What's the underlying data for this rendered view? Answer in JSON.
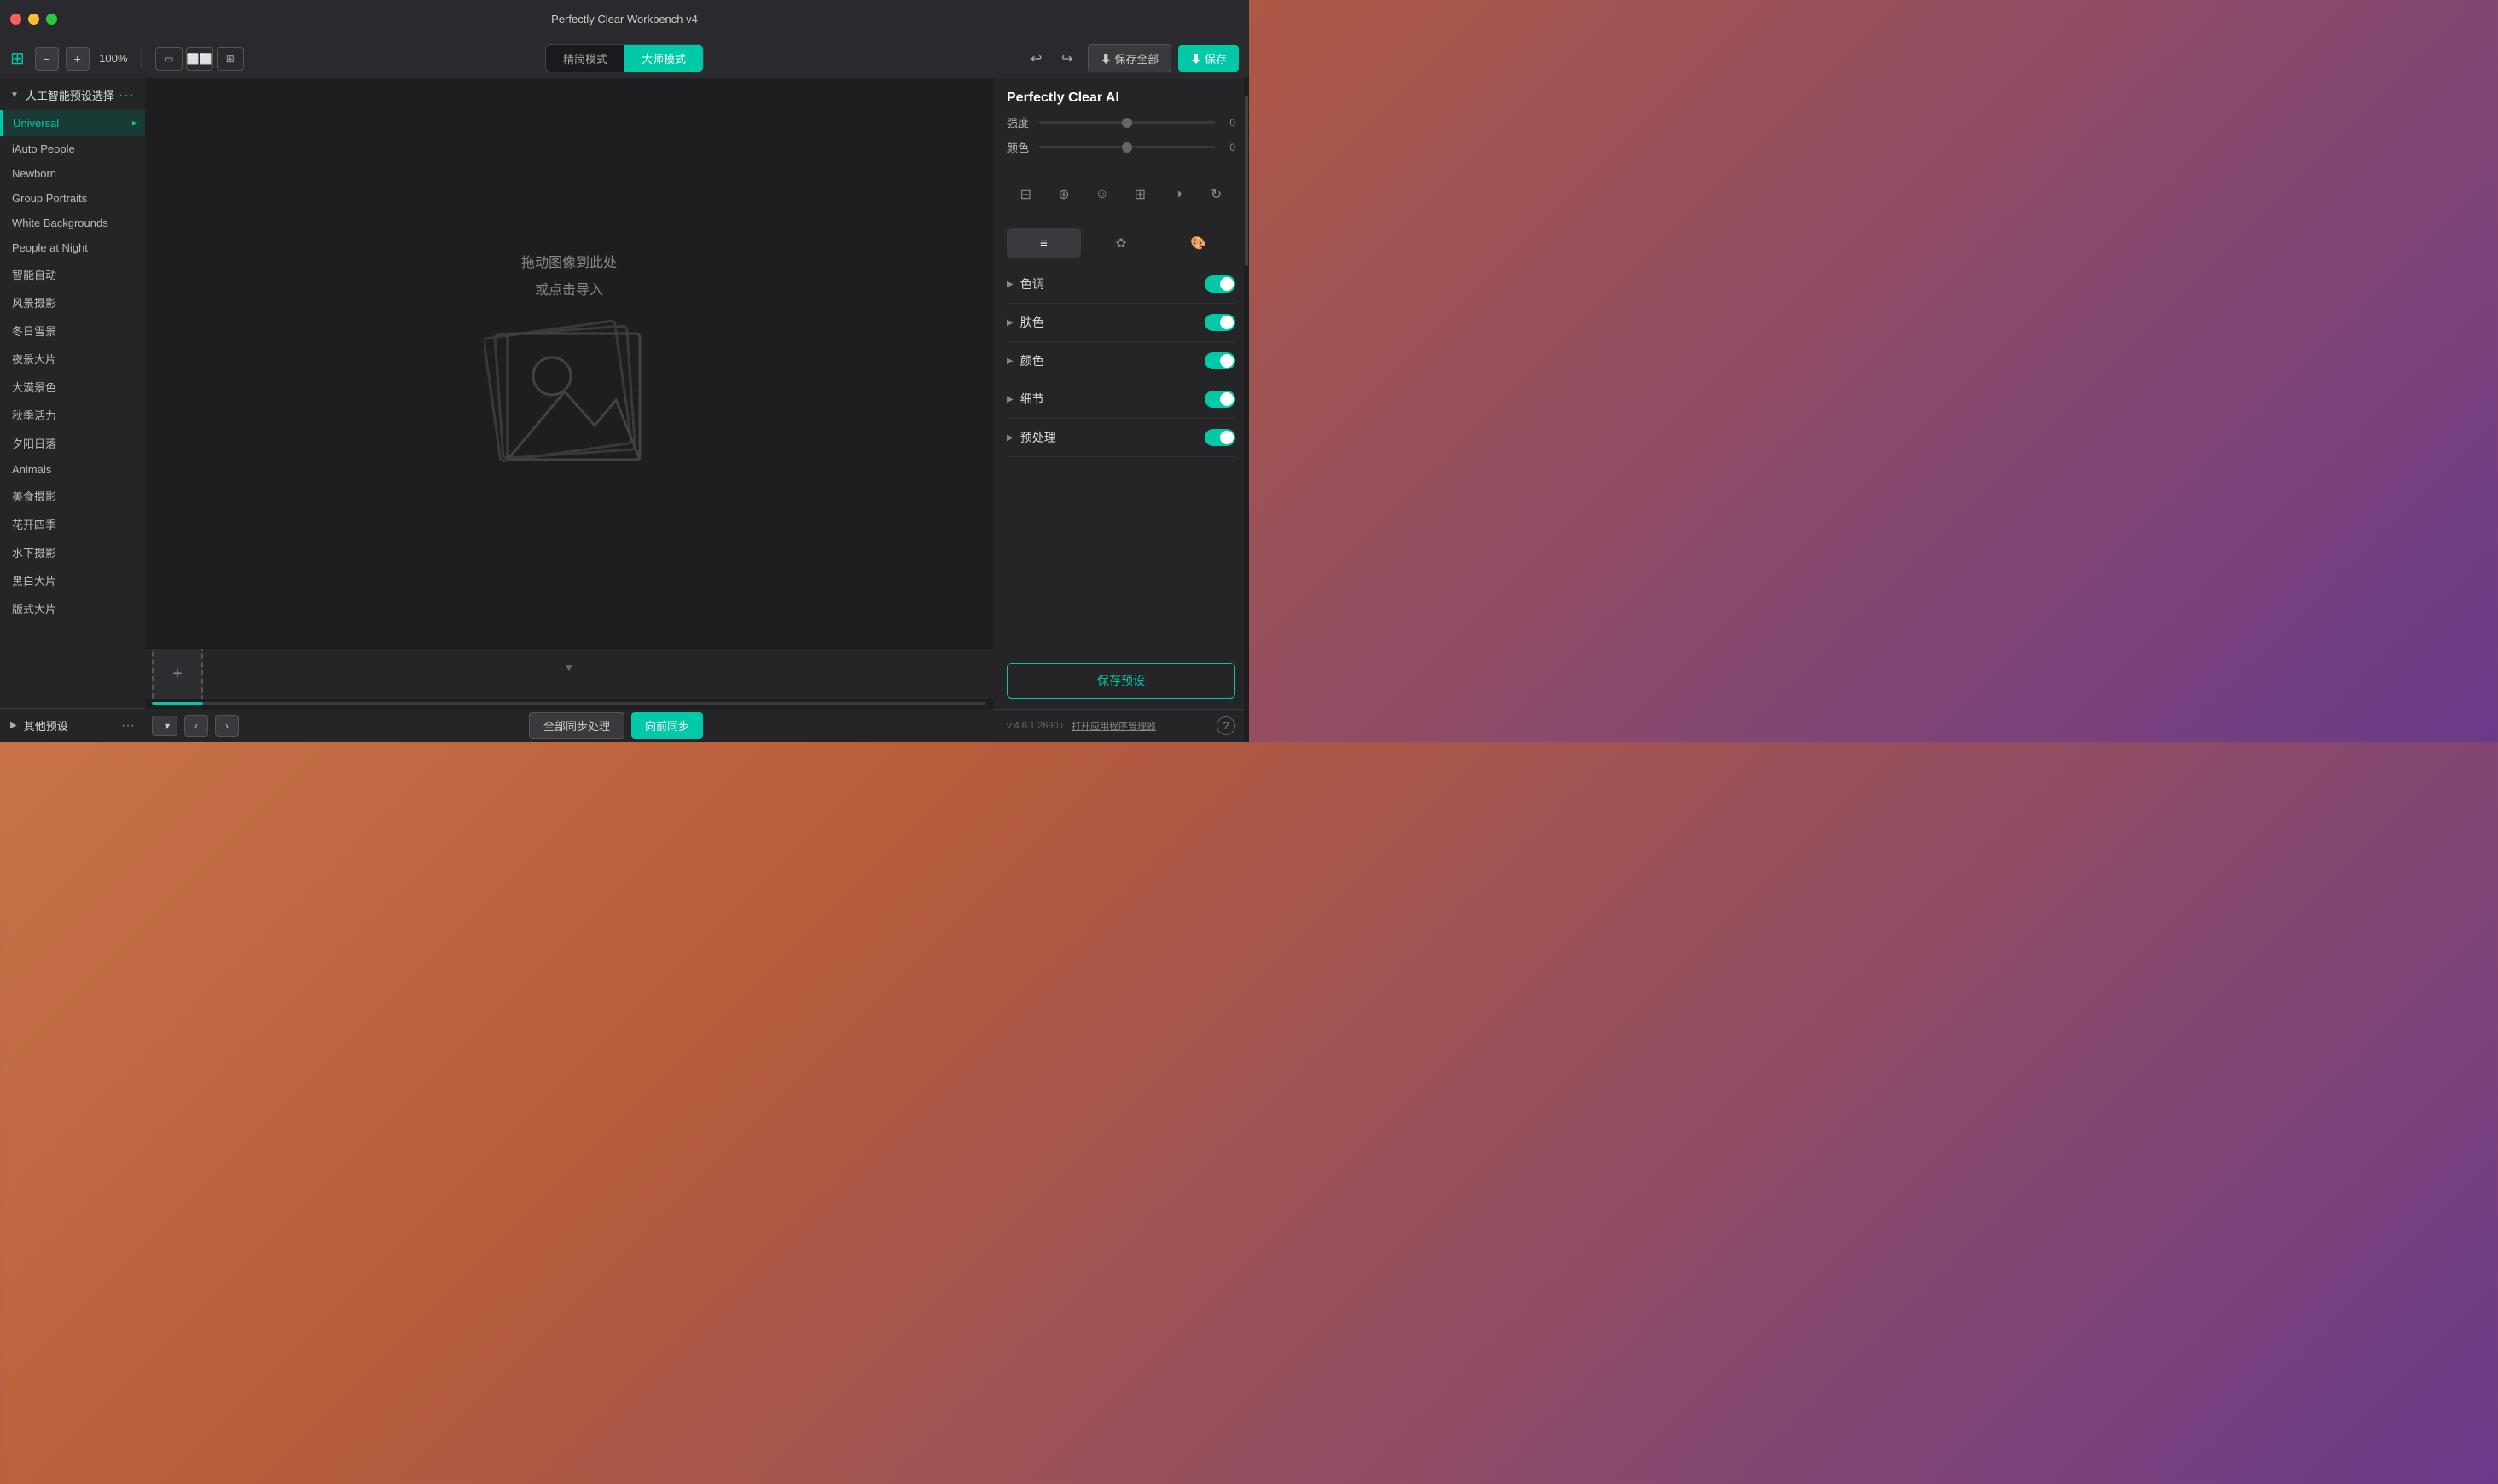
{
  "window": {
    "title": "Perfectly Clear Workbench v4"
  },
  "toolbar": {
    "logo_symbol": "⊞",
    "zoom_out_label": "−",
    "zoom_in_label": "+",
    "zoom_value": "100%",
    "view_single_label": "▭",
    "view_dual_label": "⬜⬜",
    "view_quad_label": "⬛⬛",
    "mode_simple_label": "精简模式",
    "mode_master_label": "大师模式",
    "undo_symbol": "↩",
    "redo_symbol": "↪",
    "save_all_label": "⬇ 保存全部",
    "save_label": "⬇ 保存"
  },
  "sidebar": {
    "section_header": "人工智能预设选择",
    "selected_item": "Universal",
    "items": [
      {
        "label": "iAuto People"
      },
      {
        "label": "Newborn"
      },
      {
        "label": "Group Portraits"
      },
      {
        "label": "White Backgrounds"
      },
      {
        "label": "People at Night"
      },
      {
        "label": "智能自动"
      },
      {
        "label": "风景摄影"
      },
      {
        "label": "冬日雪景"
      },
      {
        "label": "夜景大片"
      },
      {
        "label": "大漠景色"
      },
      {
        "label": "秋季活力"
      },
      {
        "label": "夕阳日落"
      },
      {
        "label": "Animals"
      },
      {
        "label": "美食摄影"
      },
      {
        "label": "花开四季"
      },
      {
        "label": "水下摄影"
      },
      {
        "label": "黑白大片"
      },
      {
        "label": "版式大片"
      }
    ],
    "other_presets_label": "其他预设"
  },
  "canvas": {
    "drop_text_line1": "拖动图像到此处",
    "drop_text_line2": "或点击导入"
  },
  "filmstrip": {
    "add_btn_symbol": "+",
    "dropdown_label": "",
    "nav_prev": "‹",
    "nav_next": "›",
    "batch_process_label": "全部同步处理",
    "sync_label": "向前同步"
  },
  "right_panel": {
    "title": "Perfectly Clear AI",
    "intensity_label": "强度",
    "intensity_value": "0",
    "color_label": "颜色",
    "color_value": "0",
    "sections": [
      {
        "label": "色调",
        "enabled": true
      },
      {
        "label": "肤色",
        "enabled": true
      },
      {
        "label": "颜色",
        "enabled": true
      },
      {
        "label": "细节",
        "enabled": true
      },
      {
        "label": "预处理",
        "enabled": true
      }
    ],
    "save_preset_label": "保存预设",
    "version": "v:4.6.1.2690.i",
    "app_manager_label": "打开应用程序管理器",
    "help_symbol": "?"
  }
}
